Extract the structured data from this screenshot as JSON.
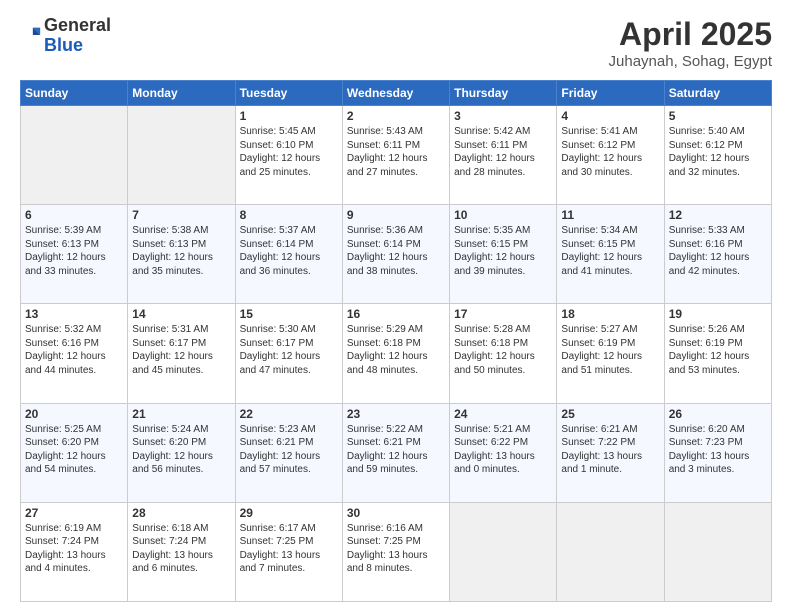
{
  "logo": {
    "general": "General",
    "blue": "Blue"
  },
  "header": {
    "month": "April 2025",
    "location": "Juhaynah, Sohag, Egypt"
  },
  "weekdays": [
    "Sunday",
    "Monday",
    "Tuesday",
    "Wednesday",
    "Thursday",
    "Friday",
    "Saturday"
  ],
  "weeks": [
    [
      {
        "day": "",
        "info": ""
      },
      {
        "day": "",
        "info": ""
      },
      {
        "day": "1",
        "info": "Sunrise: 5:45 AM\nSunset: 6:10 PM\nDaylight: 12 hours and 25 minutes."
      },
      {
        "day": "2",
        "info": "Sunrise: 5:43 AM\nSunset: 6:11 PM\nDaylight: 12 hours and 27 minutes."
      },
      {
        "day": "3",
        "info": "Sunrise: 5:42 AM\nSunset: 6:11 PM\nDaylight: 12 hours and 28 minutes."
      },
      {
        "day": "4",
        "info": "Sunrise: 5:41 AM\nSunset: 6:12 PM\nDaylight: 12 hours and 30 minutes."
      },
      {
        "day": "5",
        "info": "Sunrise: 5:40 AM\nSunset: 6:12 PM\nDaylight: 12 hours and 32 minutes."
      }
    ],
    [
      {
        "day": "6",
        "info": "Sunrise: 5:39 AM\nSunset: 6:13 PM\nDaylight: 12 hours and 33 minutes."
      },
      {
        "day": "7",
        "info": "Sunrise: 5:38 AM\nSunset: 6:13 PM\nDaylight: 12 hours and 35 minutes."
      },
      {
        "day": "8",
        "info": "Sunrise: 5:37 AM\nSunset: 6:14 PM\nDaylight: 12 hours and 36 minutes."
      },
      {
        "day": "9",
        "info": "Sunrise: 5:36 AM\nSunset: 6:14 PM\nDaylight: 12 hours and 38 minutes."
      },
      {
        "day": "10",
        "info": "Sunrise: 5:35 AM\nSunset: 6:15 PM\nDaylight: 12 hours and 39 minutes."
      },
      {
        "day": "11",
        "info": "Sunrise: 5:34 AM\nSunset: 6:15 PM\nDaylight: 12 hours and 41 minutes."
      },
      {
        "day": "12",
        "info": "Sunrise: 5:33 AM\nSunset: 6:16 PM\nDaylight: 12 hours and 42 minutes."
      }
    ],
    [
      {
        "day": "13",
        "info": "Sunrise: 5:32 AM\nSunset: 6:16 PM\nDaylight: 12 hours and 44 minutes."
      },
      {
        "day": "14",
        "info": "Sunrise: 5:31 AM\nSunset: 6:17 PM\nDaylight: 12 hours and 45 minutes."
      },
      {
        "day": "15",
        "info": "Sunrise: 5:30 AM\nSunset: 6:17 PM\nDaylight: 12 hours and 47 minutes."
      },
      {
        "day": "16",
        "info": "Sunrise: 5:29 AM\nSunset: 6:18 PM\nDaylight: 12 hours and 48 minutes."
      },
      {
        "day": "17",
        "info": "Sunrise: 5:28 AM\nSunset: 6:18 PM\nDaylight: 12 hours and 50 minutes."
      },
      {
        "day": "18",
        "info": "Sunrise: 5:27 AM\nSunset: 6:19 PM\nDaylight: 12 hours and 51 minutes."
      },
      {
        "day": "19",
        "info": "Sunrise: 5:26 AM\nSunset: 6:19 PM\nDaylight: 12 hours and 53 minutes."
      }
    ],
    [
      {
        "day": "20",
        "info": "Sunrise: 5:25 AM\nSunset: 6:20 PM\nDaylight: 12 hours and 54 minutes."
      },
      {
        "day": "21",
        "info": "Sunrise: 5:24 AM\nSunset: 6:20 PM\nDaylight: 12 hours and 56 minutes."
      },
      {
        "day": "22",
        "info": "Sunrise: 5:23 AM\nSunset: 6:21 PM\nDaylight: 12 hours and 57 minutes."
      },
      {
        "day": "23",
        "info": "Sunrise: 5:22 AM\nSunset: 6:21 PM\nDaylight: 12 hours and 59 minutes."
      },
      {
        "day": "24",
        "info": "Sunrise: 5:21 AM\nSunset: 6:22 PM\nDaylight: 13 hours and 0 minutes."
      },
      {
        "day": "25",
        "info": "Sunrise: 6:21 AM\nSunset: 7:22 PM\nDaylight: 13 hours and 1 minute."
      },
      {
        "day": "26",
        "info": "Sunrise: 6:20 AM\nSunset: 7:23 PM\nDaylight: 13 hours and 3 minutes."
      }
    ],
    [
      {
        "day": "27",
        "info": "Sunrise: 6:19 AM\nSunset: 7:24 PM\nDaylight: 13 hours and 4 minutes."
      },
      {
        "day": "28",
        "info": "Sunrise: 6:18 AM\nSunset: 7:24 PM\nDaylight: 13 hours and 6 minutes."
      },
      {
        "day": "29",
        "info": "Sunrise: 6:17 AM\nSunset: 7:25 PM\nDaylight: 13 hours and 7 minutes."
      },
      {
        "day": "30",
        "info": "Sunrise: 6:16 AM\nSunset: 7:25 PM\nDaylight: 13 hours and 8 minutes."
      },
      {
        "day": "",
        "info": ""
      },
      {
        "day": "",
        "info": ""
      },
      {
        "day": "",
        "info": ""
      }
    ]
  ]
}
